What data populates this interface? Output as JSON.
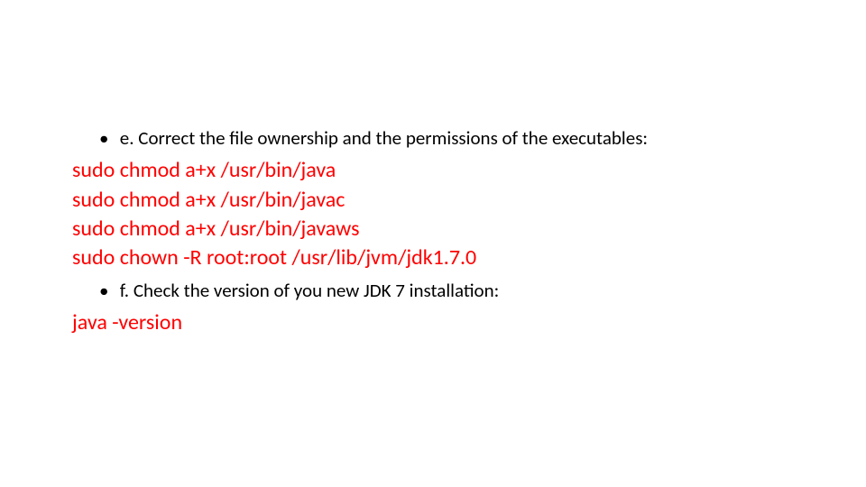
{
  "slide": {
    "bullet_e": "e. Correct the file ownership and the permissions of the executables:",
    "cmds_e": {
      "l1": "sudo chmod a+x /usr/bin/java",
      "l2": "sudo chmod a+x /usr/bin/javac",
      "l3": "sudo chmod a+x /usr/bin/javaws",
      "l4": "sudo chown -R root:root /usr/lib/jvm/jdk1.7.0"
    },
    "bullet_f": "f. Check the version of you new JDK 7 installation:",
    "cmds_f": {
      "l1": "java -version"
    },
    "colors": {
      "cmd": "#ff0000",
      "text": "#000000"
    }
  }
}
